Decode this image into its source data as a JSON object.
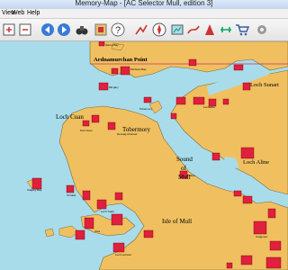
{
  "window": {
    "title": "Memory-Map - [AC Selector Mull, edition 3]"
  },
  "menu": {
    "items": [
      "View",
      "Web",
      "Help"
    ]
  },
  "map": {
    "place_labels": {
      "ardnamurchan": "Ardnamurchan Point",
      "loch_cuan": "Loch Cuan",
      "tobermory": "Tobermory",
      "loch_sunart": "Loch Sunart",
      "sound_of_mull_1": "Sound",
      "sound_of_mull_2": "of",
      "sound_of_mull_3": "Mull",
      "loch_aline": "Loch Aline",
      "isle_of_mull": "Isle of Mull"
    },
    "chart_labels": {
      "sanna_bay": "Sanna Bay",
      "kilchoan_bay": "Kilchoan Bay",
      "mingary": "Mingary",
      "port_cuan": "Port Cuan",
      "tobermory_harbour": "Tobermory",
      "lochaline": "Lochaline",
      "ulva_ferry": "Ulva",
      "calgary": "Calgary Bay",
      "loch_tuath": "Loch Tuath",
      "salen": "Salen",
      "craignure": "Craignure",
      "torloisk": "Torloisk",
      "dervaig": "Dervaig Channel",
      "loch_na_keal": "Loch na Keal"
    }
  }
}
